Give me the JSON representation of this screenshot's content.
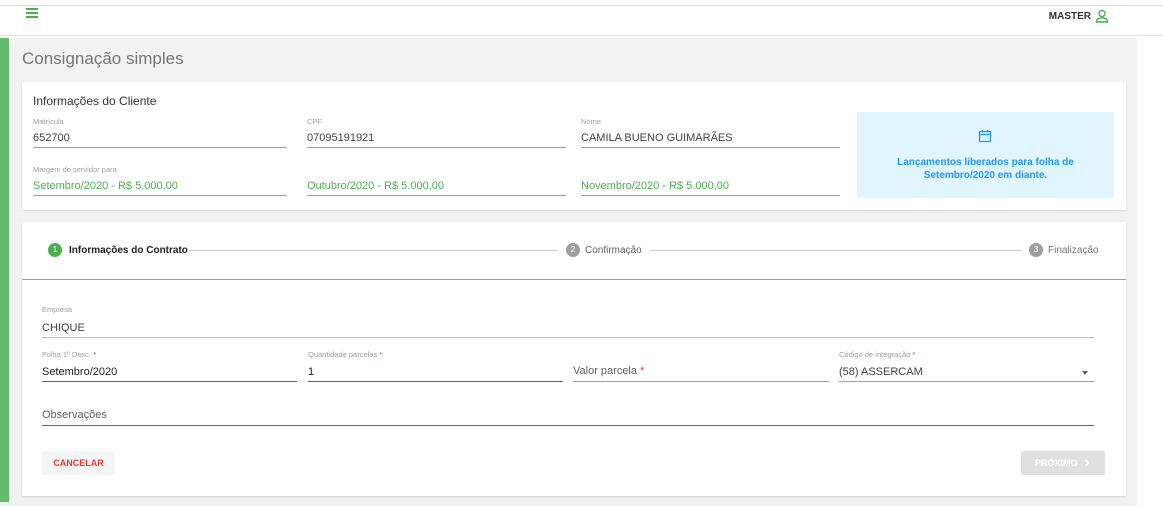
{
  "header": {
    "user_name": "MASTER"
  },
  "page": {
    "title": "Consignação simples"
  },
  "client": {
    "title": "Informações do Cliente",
    "matricula": {
      "label": "Matrícula",
      "value": "652700"
    },
    "cpf": {
      "label": "CPF",
      "value": "07095191921"
    },
    "nome": {
      "label": "Nome",
      "value": "CAMILA BUENO GUIMARÃES"
    },
    "margem_label": "Margem do servidor para",
    "margens": [
      "Setembro/2020 - R$ 5.000,00",
      "Outubro/2020 - R$ 5.000,00",
      "Novembro/2020 - R$ 5.000,00"
    ],
    "info_message": "Lançamentos liberados para folha de Setembro/2020 em diante."
  },
  "stepper": {
    "steps": [
      {
        "number": "1",
        "label": "Informações do Contrato"
      },
      {
        "number": "2",
        "label": "Confirmação"
      },
      {
        "number": "3",
        "label": "Finalização"
      }
    ]
  },
  "form": {
    "empresa": {
      "label": "Empresa",
      "value": "CHIQUE"
    },
    "folha": {
      "label": "Folha 1º Desc.",
      "value": "Setembro/2020"
    },
    "parcelas": {
      "label": "Quantidade parcelas",
      "value": "1"
    },
    "valor": {
      "placeholder": "Valor parcela"
    },
    "codigo": {
      "label": "Código de integração",
      "value": "(58) ASSERCAM"
    },
    "observacoes": {
      "placeholder": "Observações"
    },
    "required_mark": "*"
  },
  "actions": {
    "cancel_label": "CANCELAR",
    "next_label": "PRÓXIMO"
  },
  "colors": {
    "accent": "#4caf50",
    "info_bg": "#e1f5fe",
    "info_text": "#2196f3",
    "danger": "#e53935"
  }
}
